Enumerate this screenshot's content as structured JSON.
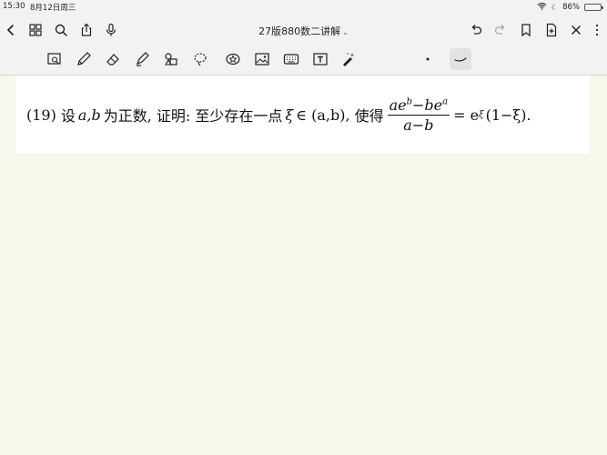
{
  "status_bar": {
    "time": "15:30",
    "date": "8月12日周三",
    "battery": "86%",
    "battery_level": 0.86
  },
  "header": {
    "title": "27版880数二讲解",
    "title_caret": "⌄"
  },
  "problem": {
    "number": "(19)",
    "text_before": "设",
    "vars": "a,b",
    "text_positive": "为正数, 证明: 至少存在一点",
    "xi": "ξ",
    "in_interval": "∈ (a,b),",
    "text_such_that": "使得",
    "frac_num_a": "ae",
    "frac_num_b_sup": "b",
    "frac_num_minus": "−be",
    "frac_num_a_sup": "a",
    "frac_den": "a−b",
    "rhs_eq": "= e",
    "rhs_sup": "ξ",
    "rhs_tail": "(1−ξ)."
  },
  "colors": {
    "canvas": "#f7f7ec",
    "chrome": "#f2f2f2",
    "page": "#ffffff"
  }
}
